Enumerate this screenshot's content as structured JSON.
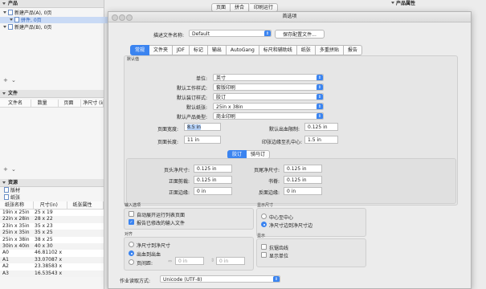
{
  "top_tabs": [
    "页面",
    "拼合",
    "印刷运行"
  ],
  "left": {
    "products_header": "产品",
    "tree": [
      {
        "label": "新建产品(A), 0页",
        "selected": false
      },
      {
        "label": "拼件, 0页",
        "selected": true
      },
      {
        "label": "新建产品(B), 0页",
        "selected": false
      }
    ],
    "files_header": "文件",
    "files_columns": [
      "文件名",
      "数量",
      "页面",
      "净尺寸 (in"
    ],
    "resources_header": "资源",
    "resource_items": [
      "版材",
      "纸张"
    ],
    "paper_columns": [
      "纸张名称",
      "尺寸(in)",
      "纸张属性"
    ],
    "paper_rows": [
      [
        "19in x 25in",
        "25 x 19"
      ],
      [
        "22in x 28in",
        "28 x 22"
      ],
      [
        "23in x 35in",
        "35 x 23"
      ],
      [
        "25in x 35in",
        "35 x 25"
      ],
      [
        "25in x 38in",
        "38 x 25"
      ],
      [
        "30in x 40in",
        "40 x 30"
      ],
      [
        "A0",
        "46.81102 x 3..."
      ],
      [
        "A1",
        "33.07087 x 2..."
      ],
      [
        "A2",
        "23.38583 x 1..."
      ],
      [
        "A3",
        "16.53543 x 1..."
      ]
    ]
  },
  "right_panel_header": "产品属性",
  "dialog": {
    "title": "首选项",
    "profile_label": "描述文件名称:",
    "profile_value": "Default",
    "save_button": "保存配置文件...",
    "tabs": [
      "常规",
      "文件夹",
      "JDF",
      "标记",
      "输出",
      "AutoGang",
      "标尺和辅助线",
      "纸张",
      "多重拼贴",
      "报告"
    ],
    "active_tab": "常规",
    "defaults_title": "默认值",
    "defaults": [
      {
        "label": "单位:",
        "value": "英寸"
      },
      {
        "label": "默认工作样式:",
        "value": "套版印刷"
      },
      {
        "label": "默认装订样式:",
        "value": "胶订"
      },
      {
        "label": "默认纸张:",
        "value": "25in x 38in"
      },
      {
        "label": "默认产品类型:",
        "value": "商业印刷"
      }
    ],
    "page_width_label": "页面宽度:",
    "page_width": "8.5 in",
    "page_height_label": "页面长度:",
    "page_height": "11 in",
    "bleed_label": "默认出血限制:",
    "bleed": "0.125 in",
    "gutter_label": "印张边缘至孔中心:",
    "gutter": "1.5 in",
    "binding_tabs": [
      "胶订",
      "骑马订"
    ],
    "binding_active": "胶订",
    "margins": [
      {
        "label": "页头净尺寸:",
        "value": "0.125 in"
      },
      {
        "label": "页尾净尺寸:",
        "value": "0.125 in"
      },
      {
        "label": "正面剪裁:",
        "value": "0.125 in"
      },
      {
        "label": "书脊:",
        "value": "0.125 in"
      },
      {
        "label": "正面边缘:",
        "value": "0 in"
      },
      {
        "label": "反面边缘:",
        "value": "0 in"
      }
    ],
    "import_title": "输入选项",
    "import_options": [
      {
        "label": "自动展开运行列表页面",
        "checked": false
      },
      {
        "label": "报告已修改的输入文件",
        "checked": true
      }
    ],
    "display_size_title": "显示尺寸",
    "display_size_options": [
      {
        "label": "中心至中心",
        "selected": false
      },
      {
        "label": "净尺寸边到净尺寸边",
        "selected": true
      }
    ],
    "align_title": "对齐",
    "align_options": [
      {
        "label": "净尺寸到净尺寸",
        "selected": false
      },
      {
        "label": "出血到出血",
        "selected": true
      },
      {
        "label": "页间距:",
        "selected": false
      }
    ],
    "spacing_h": "0 in",
    "spacing_v": "0 in",
    "show_title": "显示",
    "show_options": [
      {
        "label": "抗锯齿线",
        "checked": false
      },
      {
        "label": "显示单位",
        "checked": false
      }
    ],
    "encoding_label": "作业读取方式:",
    "encoding_value": "Unicode (UTF-8)"
  },
  "colors": {
    "accent": "#3b84f0",
    "selection": "#c9daf5"
  }
}
